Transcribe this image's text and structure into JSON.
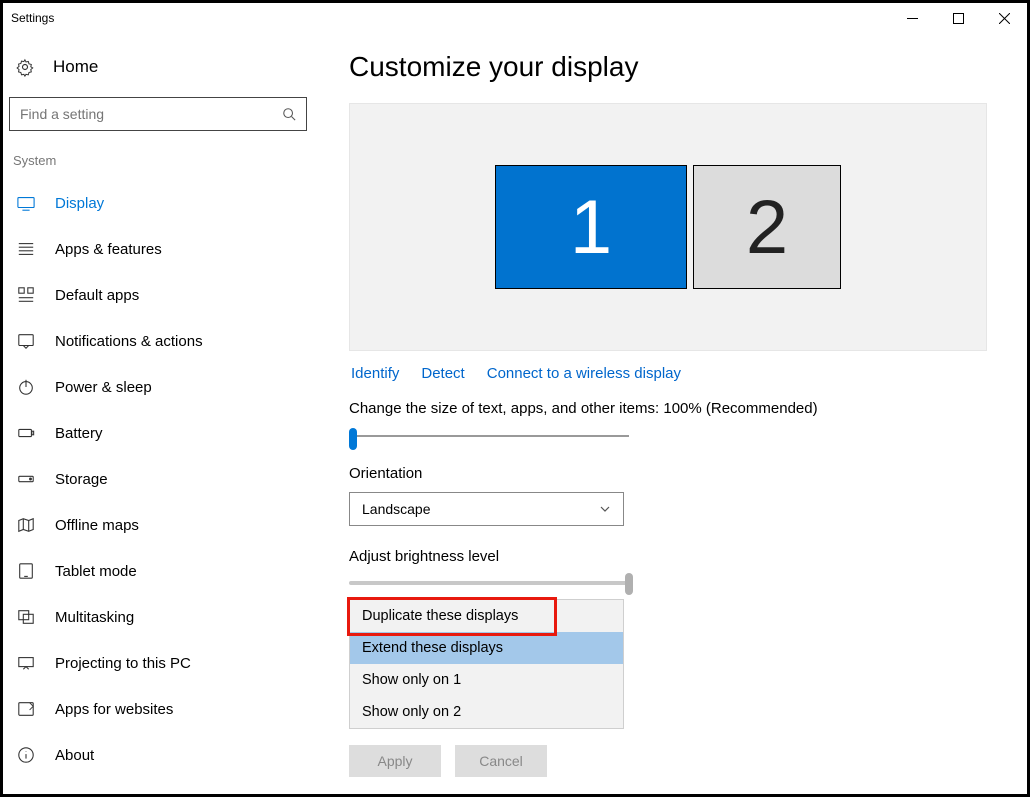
{
  "window": {
    "title": "Settings"
  },
  "sidebar": {
    "home_label": "Home",
    "search_placeholder": "Find a setting",
    "section_label": "System",
    "items": [
      {
        "label": "Display",
        "active": true,
        "icon": "display"
      },
      {
        "label": "Apps & features",
        "active": false,
        "icon": "apps"
      },
      {
        "label": "Default apps",
        "active": false,
        "icon": "default-apps"
      },
      {
        "label": "Notifications & actions",
        "active": false,
        "icon": "notifications"
      },
      {
        "label": "Power & sleep",
        "active": false,
        "icon": "power"
      },
      {
        "label": "Battery",
        "active": false,
        "icon": "battery"
      },
      {
        "label": "Storage",
        "active": false,
        "icon": "storage"
      },
      {
        "label": "Offline maps",
        "active": false,
        "icon": "maps"
      },
      {
        "label": "Tablet mode",
        "active": false,
        "icon": "tablet"
      },
      {
        "label": "Multitasking",
        "active": false,
        "icon": "multitasking"
      },
      {
        "label": "Projecting to this PC",
        "active": false,
        "icon": "projecting"
      },
      {
        "label": "Apps for websites",
        "active": false,
        "icon": "apps-web"
      },
      {
        "label": "About",
        "active": false,
        "icon": "about"
      }
    ]
  },
  "main": {
    "title": "Customize your display",
    "monitor1": "1",
    "monitor2": "2",
    "links": {
      "identify": "Identify",
      "detect": "Detect",
      "wireless": "Connect to a wireless display"
    },
    "scale_label": "Change the size of text, apps, and other items: 100% (Recommended)",
    "orientation_label": "Orientation",
    "orientation_value": "Landscape",
    "brightness_label": "Adjust brightness level",
    "multi_display_options": [
      "Duplicate these displays",
      "Extend these displays",
      "Show only on 1",
      "Show only on 2"
    ],
    "apply_label": "Apply",
    "cancel_label": "Cancel"
  }
}
